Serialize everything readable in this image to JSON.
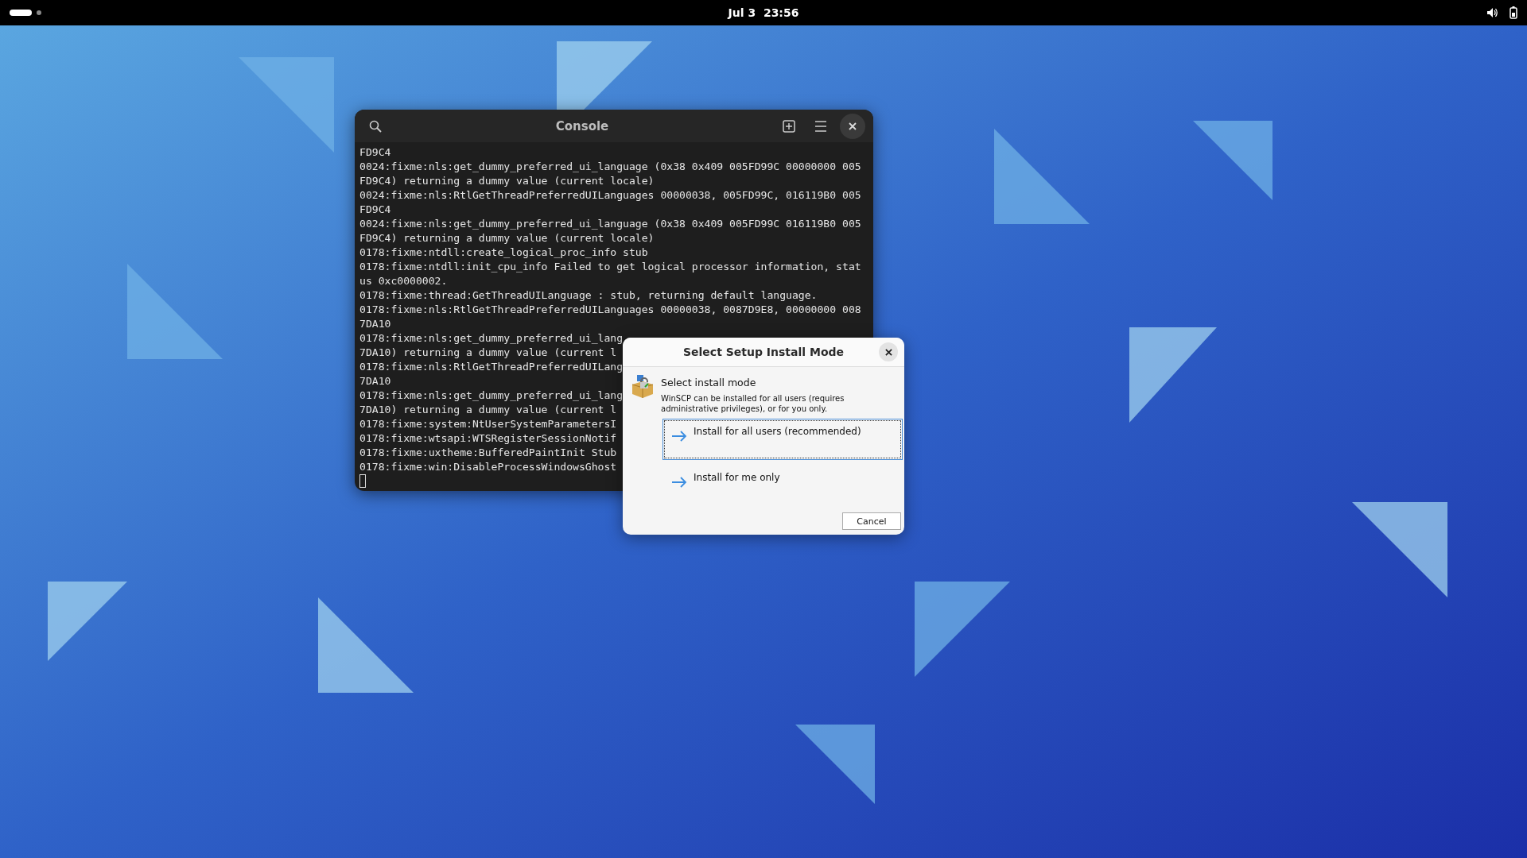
{
  "top_bar": {
    "clock": "Jul 3  23:56"
  },
  "console": {
    "title": "Console",
    "lines": [
      "FD9C4",
      "0024:fixme:nls:get_dummy_preferred_ui_language (0x38 0x409 005FD99C 00000000 005",
      "FD9C4) returning a dummy value (current locale)",
      "0024:fixme:nls:RtlGetThreadPreferredUILanguages 00000038, 005FD99C, 016119B0 005",
      "FD9C4",
      "0024:fixme:nls:get_dummy_preferred_ui_language (0x38 0x409 005FD99C 016119B0 005",
      "FD9C4) returning a dummy value (current locale)",
      "0178:fixme:ntdll:create_logical_proc_info stub",
      "0178:fixme:ntdll:init_cpu_info Failed to get logical processor information, stat",
      "us 0xc0000002.",
      "0178:fixme:thread:GetThreadUILanguage : stub, returning default language.",
      "0178:fixme:nls:RtlGetThreadPreferredUILanguages 00000038, 0087D9E8, 00000000 008",
      "7DA10",
      "0178:fixme:nls:get_dummy_preferred_ui_lang",
      "7DA10) returning a dummy value (current l",
      "0178:fixme:nls:RtlGetThreadPreferredUILang",
      "7DA10",
      "0178:fixme:nls:get_dummy_preferred_ui_lang",
      "7DA10) returning a dummy value (current l",
      "0178:fixme:system:NtUserSystemParametersI",
      "0178:fixme:wtsapi:WTSRegisterSessionNotif",
      "0178:fixme:uxtheme:BufferedPaintInit Stub",
      "0178:fixme:win:DisableProcessWindowsGhost"
    ]
  },
  "dialog": {
    "title": "Select Setup Install Mode",
    "heading": "Select install mode",
    "description": "WinSCP can be installed for all users (requires administrative privileges), or for you only.",
    "options": [
      {
        "label": "Install for all users (recommended)",
        "selected": true
      },
      {
        "label": "Install for me only",
        "selected": false
      }
    ],
    "buttons": [
      "Cancel"
    ]
  }
}
